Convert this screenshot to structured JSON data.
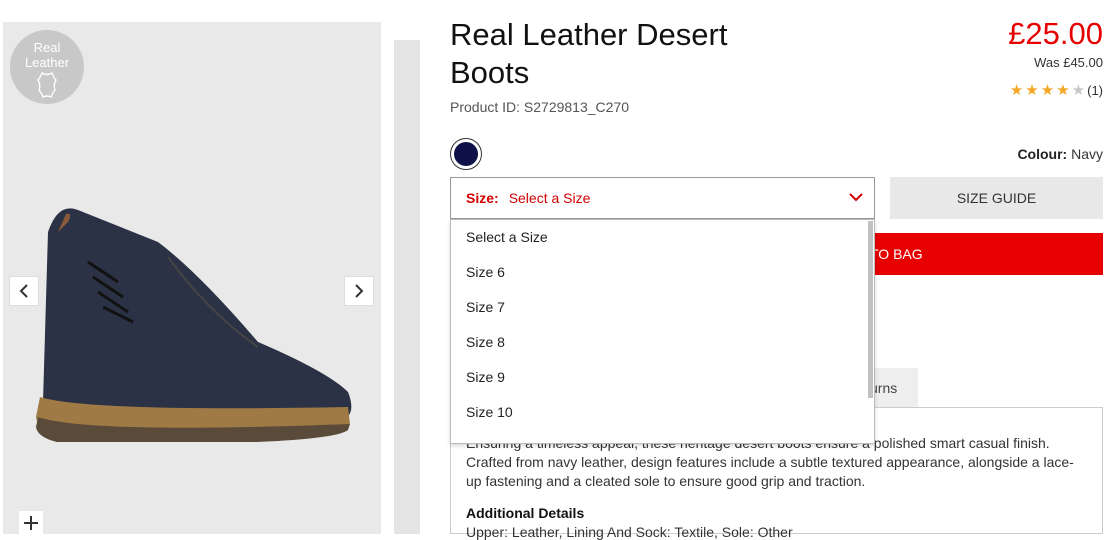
{
  "gallery": {
    "badge_line1": "Real",
    "badge_line2": "Leather",
    "prev_icon": "chevron-left-icon",
    "next_icon": "chevron-right-icon",
    "zoom_icon": "plus-icon"
  },
  "product": {
    "title_line1": "Real Leather Desert",
    "title_line2": "Boots",
    "product_id": "Product ID: S2729813_C270",
    "price": "£25.00",
    "was_price": "Was £45.00",
    "rating": 4,
    "rating_max": 5,
    "review_count": "(1)",
    "colour_label": "Colour:",
    "colour_value": "Navy",
    "swatch_color": "#0e1248",
    "accent_color": "#e60000"
  },
  "size": {
    "label": "Size:",
    "value": "Select a Size",
    "options": [
      "Select a Size",
      "Size 6",
      "Size 7",
      "Size 8",
      "Size 9",
      "Size 10"
    ],
    "guide_label": "SIZE GUIDE"
  },
  "actions": {
    "add_to_bag_visible": "TO BAG"
  },
  "tabs": {
    "returns_visible": "urns"
  },
  "description": {
    "line1": "Ensuring a timeless appeal, these heritage desert boots ensure a polished smart casual finish.",
    "line2": "Crafted from navy leather, design features include a subtle textured appearance, alongside a lace-",
    "line3": "up fastening and a cleated sole to ensure good grip and traction.",
    "additional_heading": "Additional Details",
    "additional_text": "Upper: Leather, Lining And Sock: Textile, Sole: Other"
  }
}
